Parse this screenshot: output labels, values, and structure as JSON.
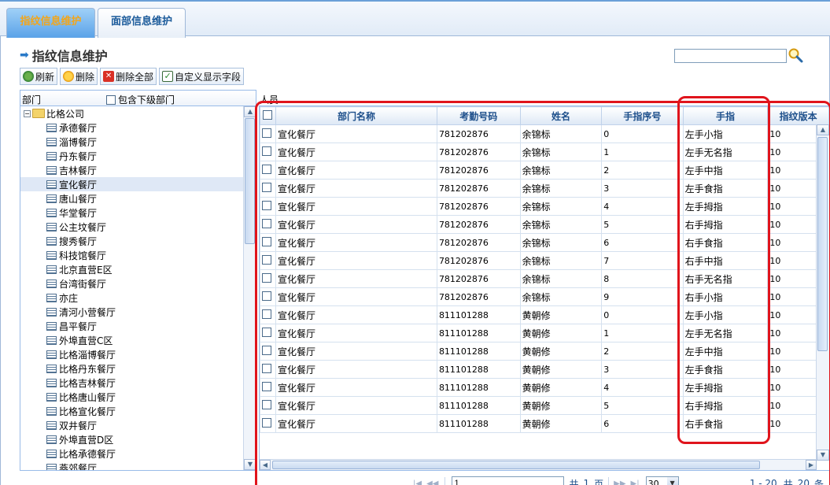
{
  "tabs": [
    {
      "label": "指纹信息维护"
    },
    {
      "label": "面部信息维护"
    }
  ],
  "page": {
    "title": "指纹信息维护"
  },
  "search": {
    "placeholder": ""
  },
  "toolbar": {
    "refresh": "刷新",
    "delete": "删除",
    "delete_all": "删除全部",
    "custom_fields": "自定义显示字段"
  },
  "left_panel": {
    "header_label": "部门",
    "include_sub_label": "包含下级部门",
    "root": "比格公司",
    "items": [
      "承德餐厅",
      "淄博餐厅",
      "丹东餐厅",
      "吉林餐厅",
      "宣化餐厅",
      "唐山餐厅",
      "华堂餐厅",
      "公主坟餐厅",
      "搜秀餐厅",
      "科技馆餐厅",
      "北京直营E区",
      "台湾街餐厅",
      "亦庄",
      "清河小营餐厅",
      "昌平餐厅",
      "外埠直营C区",
      "比格淄博餐厅",
      "比格丹东餐厅",
      "比格吉林餐厅",
      "比格唐山餐厅",
      "比格宣化餐厅",
      "双井餐厅",
      "外埠直营D区",
      "比格承德餐厅",
      "燕郊餐厅"
    ],
    "selected": "宣化餐厅"
  },
  "right_panel": {
    "label": "人员"
  },
  "grid": {
    "columns": [
      "部门名称",
      "考勤号码",
      "姓名",
      "手指序号",
      "手指",
      "指纹版本"
    ],
    "rows": [
      [
        "宣化餐厅",
        "781202876",
        "余锦标",
        "0",
        "左手小指",
        "10"
      ],
      [
        "宣化餐厅",
        "781202876",
        "余锦标",
        "1",
        "左手无名指",
        "10"
      ],
      [
        "宣化餐厅",
        "781202876",
        "余锦标",
        "2",
        "左手中指",
        "10"
      ],
      [
        "宣化餐厅",
        "781202876",
        "余锦标",
        "3",
        "左手食指",
        "10"
      ],
      [
        "宣化餐厅",
        "781202876",
        "余锦标",
        "4",
        "左手拇指",
        "10"
      ],
      [
        "宣化餐厅",
        "781202876",
        "余锦标",
        "5",
        "右手拇指",
        "10"
      ],
      [
        "宣化餐厅",
        "781202876",
        "余锦标",
        "6",
        "右手食指",
        "10"
      ],
      [
        "宣化餐厅",
        "781202876",
        "余锦标",
        "7",
        "右手中指",
        "10"
      ],
      [
        "宣化餐厅",
        "781202876",
        "余锦标",
        "8",
        "右手无名指",
        "10"
      ],
      [
        "宣化餐厅",
        "781202876",
        "余锦标",
        "9",
        "右手小指",
        "10"
      ],
      [
        "宣化餐厅",
        "811101288",
        "黄朝修",
        "0",
        "左手小指",
        "10"
      ],
      [
        "宣化餐厅",
        "811101288",
        "黄朝修",
        "1",
        "左手无名指",
        "10"
      ],
      [
        "宣化餐厅",
        "811101288",
        "黄朝修",
        "2",
        "左手中指",
        "10"
      ],
      [
        "宣化餐厅",
        "811101288",
        "黄朝修",
        "3",
        "左手食指",
        "10"
      ],
      [
        "宣化餐厅",
        "811101288",
        "黄朝修",
        "4",
        "左手拇指",
        "10"
      ],
      [
        "宣化餐厅",
        "811101288",
        "黄朝修",
        "5",
        "右手拇指",
        "10"
      ],
      [
        "宣化餐厅",
        "811101288",
        "黄朝修",
        "6",
        "右手食指",
        "10"
      ]
    ]
  },
  "pager": {
    "page_input": "1",
    "total_pages_prefix": "共",
    "total_pages": "1",
    "total_pages_suffix": "页",
    "page_size": "30",
    "range": "1 - 20",
    "total_prefix": "共",
    "total_records": "20",
    "total_suffix": "条"
  },
  "colors": {
    "highlight": "#e0141c",
    "header_text": "#1d4f8b",
    "active_tab_text": "#f3a61a"
  }
}
